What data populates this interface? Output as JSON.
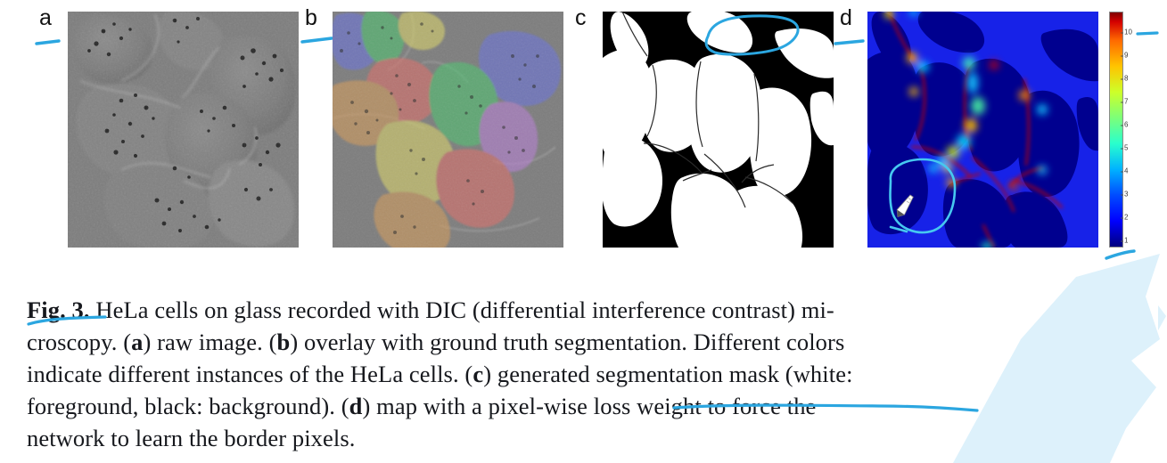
{
  "figure": {
    "id": "Fig. 3.",
    "panels": [
      {
        "key": "a",
        "label": "a",
        "name": "raw-dic-image",
        "description": "raw grayscale DIC microscopy image of HeLa cells on glass"
      },
      {
        "key": "b",
        "label": "b",
        "name": "ground-truth-overlay",
        "description": "overlay with ground truth segmentation, different colors per instance"
      },
      {
        "key": "c",
        "label": "c",
        "name": "segmentation-mask",
        "description": "generated binary segmentation mask, white foreground, black background"
      },
      {
        "key": "d",
        "label": "d",
        "name": "loss-weight-map",
        "description": "pixel-wise loss weight map forcing the network to learn border pixels"
      }
    ]
  },
  "colorbar": {
    "name": "loss-weight-colorbar",
    "colormap": "jet",
    "min": 1,
    "max": 10,
    "ticks": [
      "10",
      "9",
      "8",
      "7",
      "6",
      "5",
      "4",
      "3",
      "2",
      "1"
    ]
  },
  "caption": {
    "prefix": "Fig. 3.",
    "lines": [
      "HeLa cells on glass recorded with DIC (differential interference contrast) mi-",
      "croscopy. (a) raw image. (b) overlay with ground truth segmentation. Different colors",
      "indicate different instances of the HeLa cells. (c) generated segmentation mask (white:",
      "foreground, black: background). (d) map with a pixel-wise loss weight to force the",
      "network to learn the border pixels."
    ],
    "full_text": "Fig. 3. HeLa cells on glass recorded with DIC (differential interference contrast) microscopy. (a) raw image. (b) overlay with ground truth segmentation. Different colors indicate different instances of the HeLa cells. (c) generated segmentation mask (white: foreground, black: background). (d) map with a pixel-wise loss weight to force the network to learn the border pixels."
  },
  "annotations": {
    "ink_color": "#2ba6e0",
    "items": [
      {
        "name": "ink-dash-near-panel-a",
        "type": "dash"
      },
      {
        "name": "ink-dash-near-panel-b",
        "type": "dash"
      },
      {
        "name": "ink-lasso-panel-c",
        "type": "lasso"
      },
      {
        "name": "ink-dash-near-panel-d",
        "type": "dash"
      },
      {
        "name": "ink-lasso-panel-d",
        "type": "lasso"
      },
      {
        "name": "ink-dash-colorbar-top",
        "type": "dash"
      },
      {
        "name": "ink-dash-colorbar-bottom",
        "type": "dash"
      },
      {
        "name": "ink-underline-fig-label",
        "type": "underline"
      },
      {
        "name": "ink-underline-caption-last-line",
        "type": "underline"
      }
    ],
    "cursor": {
      "name": "pen-cursor",
      "inside_panel": "d"
    }
  },
  "instance_colors": {
    "blue": "#6b73d8",
    "green": "#4fc070",
    "yellow": "#d6d06a",
    "red": "#d9706a",
    "orange": "#d09a5c",
    "purple": "#b57fd1"
  },
  "watermark": {
    "name": "brush-watermark",
    "color": "#dcf0fa"
  }
}
